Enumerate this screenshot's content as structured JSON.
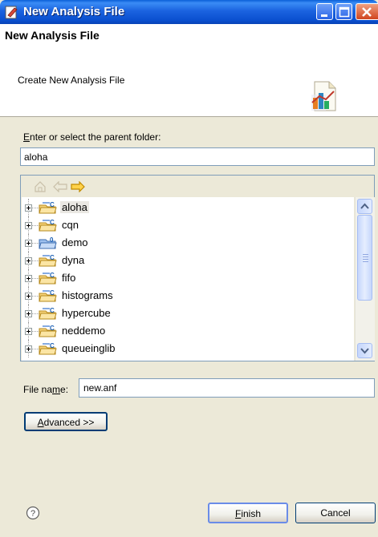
{
  "window": {
    "title": "New Analysis File"
  },
  "header": {
    "title": "New Analysis File",
    "description": "Create New Analysis File"
  },
  "folder": {
    "label_mnemonic": "E",
    "label_rest": "nter or select the parent folder:",
    "value": "aloha"
  },
  "tree": {
    "items": [
      {
        "label": "aloha",
        "type": "project",
        "selected": true
      },
      {
        "label": "cqn",
        "type": "project"
      },
      {
        "label": "demo",
        "type": "folder"
      },
      {
        "label": "dyna",
        "type": "project"
      },
      {
        "label": "fifo",
        "type": "project"
      },
      {
        "label": "histograms",
        "type": "project"
      },
      {
        "label": "hypercube",
        "type": "project"
      },
      {
        "label": "neddemo",
        "type": "project"
      },
      {
        "label": "queueinglib",
        "type": "project"
      }
    ]
  },
  "file_name": {
    "label_a": "File na",
    "label_mnemonic": "m",
    "label_b": "e:",
    "value": "new.anf"
  },
  "buttons": {
    "advanced_mnemonic": "A",
    "advanced_rest": "dvanced >>",
    "finish_mnemonic": "F",
    "finish_rest": "inish",
    "cancel": "Cancel"
  },
  "icons": {
    "title_icon": "new-file-icon",
    "header_icon": "analysis-chart-icon",
    "home": "home-icon",
    "back": "back-arrow-icon",
    "forward": "forward-arrow-icon",
    "help": "help-icon"
  },
  "colors": {
    "titlebar": "#0a4fcf",
    "dialog_bg": "#ece9d8",
    "selection": "#eae8e3"
  }
}
